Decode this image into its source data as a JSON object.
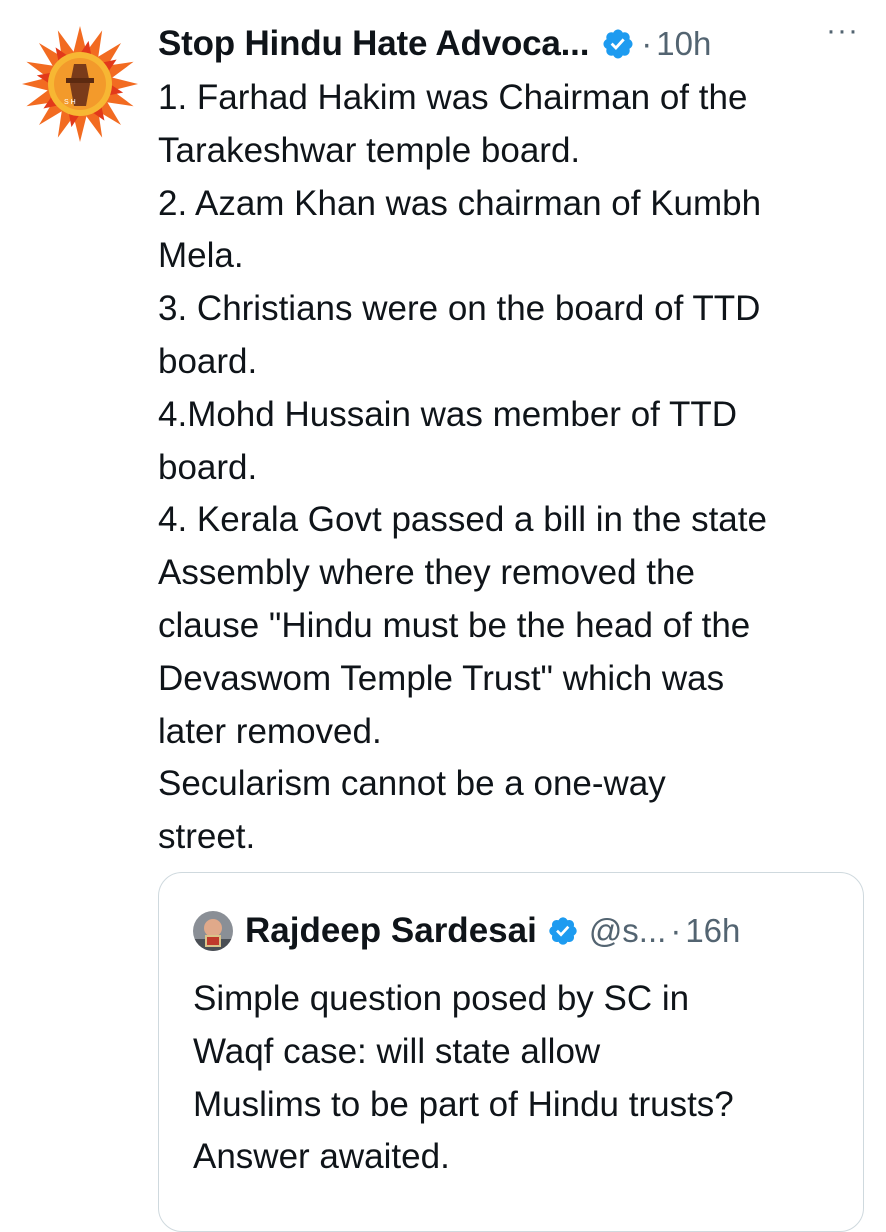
{
  "tweet": {
    "author": "Stop Hindu Hate Advoca...",
    "verified_icon": "verified-badge-icon",
    "separator": "·",
    "time": "10h",
    "more_label": "···",
    "avatar_icon": "sunburst-logo-icon",
    "lines": [
      "1. Farhad Hakim was Chairman of the",
      "Tarakeshwar temple board.",
      "2. Azam Khan was chairman of Kumbh",
      "Mela.",
      "3. Christians were on the board of TTD",
      "board.",
      "4.Mohd Hussain was member of TTD",
      "board.",
      "4. Kerala Govt passed a bill in the state",
      "Assembly where they removed the",
      "clause \"Hindu must be the head of the",
      "Devaswom Temple Trust\" which was",
      "later removed.",
      "Secularism cannot be a one-way",
      "street."
    ]
  },
  "quote": {
    "author": "Rajdeep Sardesai",
    "verified_icon": "verified-badge-icon",
    "handle": "@s...",
    "separator": "·",
    "time": "16h",
    "lines": [
      "Simple question posed by SC in",
      "Waqf case: will state allow",
      "Muslims to be part of Hindu trusts?",
      "Answer awaited."
    ]
  },
  "colors": {
    "text": "#0f1419",
    "secondary": "#536471",
    "verified": "#1d9bf0",
    "border": "#cfd9de",
    "logo_orange": "#f26b21"
  }
}
